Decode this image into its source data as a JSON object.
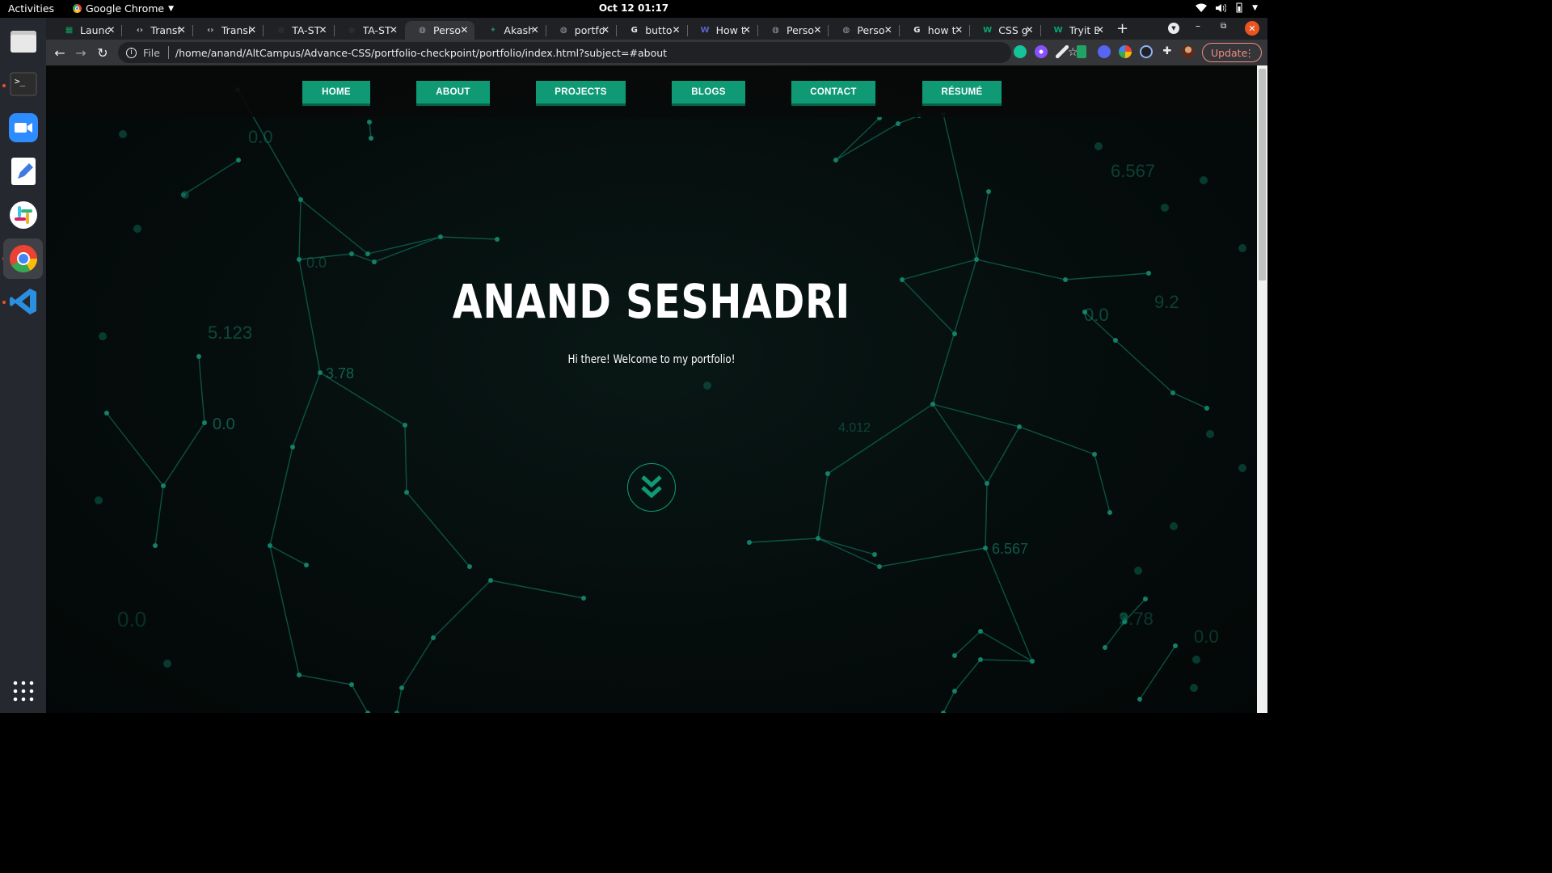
{
  "topbar": {
    "activities": "Activities",
    "app_name": "Google Chrome",
    "clock": "Oct 12  01:17"
  },
  "dock": {
    "items": [
      {
        "name": "files",
        "icon": "folder-icon"
      },
      {
        "name": "terminal",
        "icon": "terminal-icon"
      },
      {
        "name": "zoom",
        "icon": "zoom-icon"
      },
      {
        "name": "text-editor",
        "icon": "text-editor-icon"
      },
      {
        "name": "slack",
        "icon": "slack-icon"
      },
      {
        "name": "chrome",
        "icon": "chrome-icon"
      },
      {
        "name": "vscode",
        "icon": "vscode-icon"
      }
    ],
    "show_apps_icon": "app-grid-icon"
  },
  "tabs": [
    {
      "title": "Launc",
      "icon": "sheets-icon"
    },
    {
      "title": "Transf",
      "icon": "code-icon"
    },
    {
      "title": "Transi",
      "icon": "code-icon"
    },
    {
      "title": "TA-ST",
      "icon": "github-icon"
    },
    {
      "title": "TA-ST",
      "icon": "github-icon"
    },
    {
      "title": "Perso",
      "icon": "globe-icon",
      "active": true
    },
    {
      "title": "Akash",
      "icon": "leaf-icon"
    },
    {
      "title": "portfo",
      "icon": "globe-icon"
    },
    {
      "title": "butto",
      "icon": "google-icon"
    },
    {
      "title": "How t",
      "icon": "w3-icon"
    },
    {
      "title": "Perso",
      "icon": "globe-icon"
    },
    {
      "title": "Perso",
      "icon": "globe-icon"
    },
    {
      "title": "how t",
      "icon": "google-icon"
    },
    {
      "title": "CSS gr",
      "icon": "w-icon"
    },
    {
      "title": "Tryit E",
      "icon": "w-icon"
    }
  ],
  "toolbar": {
    "scheme_label": "File",
    "url": "/home/anand/AltCampus/Advance-CSS/portfolio-checkpoint/portfolio/index.html?subject=#about",
    "update_label": "Update"
  },
  "page": {
    "nav": [
      "HOME",
      "ABOUT",
      "PROJECTS",
      "BLOGS",
      "CONTACT",
      "RÉSUMÉ"
    ],
    "hero_name": "ANAND SESHADRI",
    "hero_tagline": "Hi there! Welcome to my portfolio!",
    "background_numbers": [
      "0.0",
      "6.567",
      "0.0",
      "5.123",
      "3.78",
      "0.0",
      "0.0",
      "9.2",
      "4.012",
      "6.567",
      "0.0",
      "3.78",
      "0.0"
    ],
    "accent_color": "#0f9a75"
  }
}
